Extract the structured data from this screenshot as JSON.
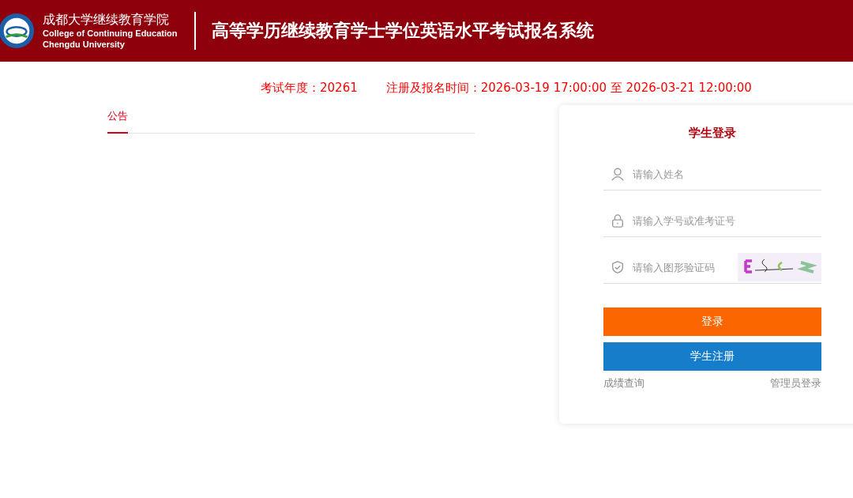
{
  "header": {
    "school_name": "成都大学继续教育学院",
    "school_name_en_1": "College of Continuing Education",
    "school_name_en_2": "Chengdu University",
    "system_title": "高等学历继续教育学士学位英语水平考试报名系统"
  },
  "exam_info": {
    "year": "考试年度：20261",
    "period": "注册及报名时间：2026-03-19 17:00:00 至 2026-03-21 12:00:00"
  },
  "tabs": [
    {
      "label": "公告",
      "selected": true
    }
  ],
  "login": {
    "title": "学生登录",
    "fields": [
      {
        "kind": "user",
        "placeholder": "请输入姓名"
      },
      {
        "kind": "lock",
        "placeholder": "请输入学号或准考证号"
      },
      {
        "kind": "captcha",
        "placeholder": "请输入图形验证码"
      }
    ],
    "login_button": "登录",
    "register_button": "学生注册",
    "score_link": "成绩查询",
    "admin_link": "管理员登录"
  }
}
